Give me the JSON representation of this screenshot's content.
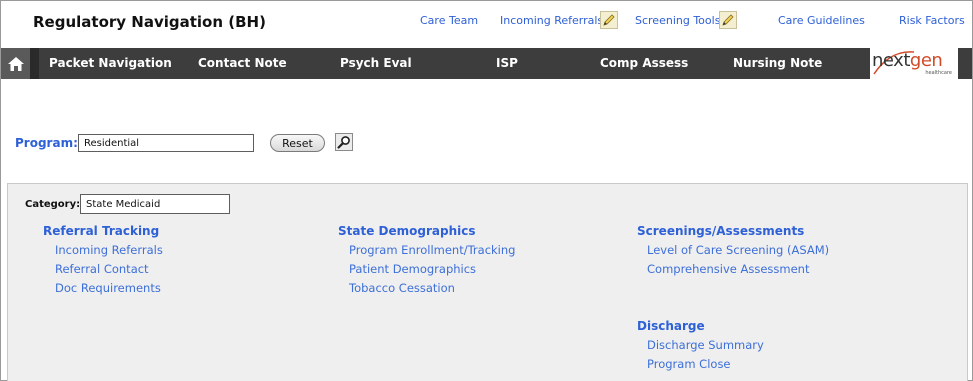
{
  "app": {
    "title": "Regulatory Navigation (BH)"
  },
  "top_links": [
    {
      "label": "Care Team"
    },
    {
      "label": "Incoming Referrals",
      "icon": "pencil-icon"
    },
    {
      "label": "Screening Tools",
      "icon": "pencil-icon"
    },
    {
      "label": "Care Guidelines"
    },
    {
      "label": "Risk Factors"
    }
  ],
  "nav": {
    "home_icon": "home-icon",
    "items": [
      {
        "label": "Packet Navigation"
      },
      {
        "label": "Contact Note"
      },
      {
        "label": "Psych Eval"
      },
      {
        "label": "ISP"
      },
      {
        "label": "Comp Assess"
      },
      {
        "label": "Nursing Note"
      }
    ],
    "logo": {
      "text_a": "next",
      "text_b": "gen",
      "sub": "healthcare"
    }
  },
  "program": {
    "label": "Program:",
    "value": "Residential",
    "reset_label": "Reset",
    "search_icon": "magnifier-icon"
  },
  "category": {
    "label": "Category:",
    "value": "State Medicaid"
  },
  "sections": {
    "referral": {
      "title": "Referral Tracking",
      "links": [
        "Incoming Referrals",
        "Referral Contact",
        "Doc Requirements"
      ]
    },
    "demographics": {
      "title": "State Demographics",
      "links": [
        "Program Enrollment/Tracking",
        "Patient Demographics",
        "Tobacco Cessation"
      ]
    },
    "screenings": {
      "title": "Screenings/Assessments",
      "links": [
        "Level of Care Screening (ASAM)",
        "Comprehensive Assessment"
      ]
    },
    "discharge": {
      "title": "Discharge",
      "links": [
        "Discharge Summary",
        "Program Close"
      ]
    }
  },
  "colors": {
    "link": "#2e60d6",
    "navbar": "#3d3d3d",
    "panel": "#efefef",
    "logo_accent": "#d24b2a"
  }
}
